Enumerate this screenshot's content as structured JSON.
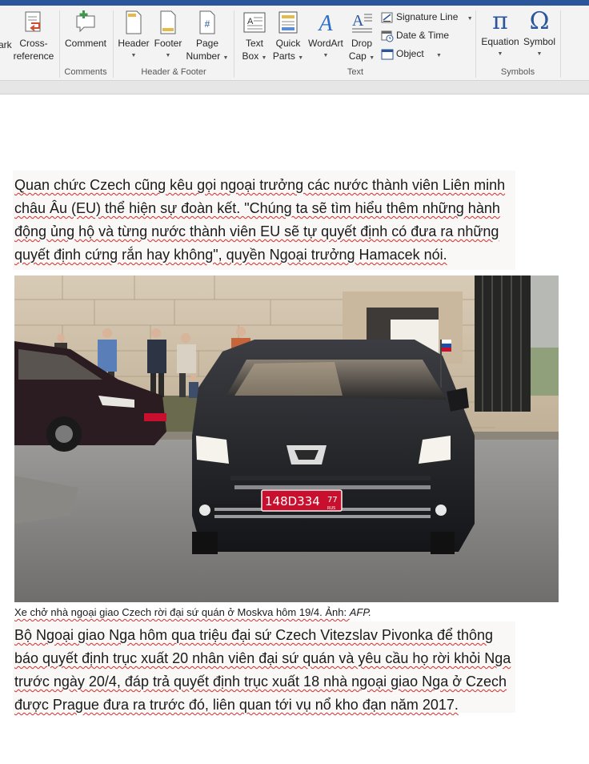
{
  "ribbon": {
    "groups": {
      "comments": "Comments",
      "header_footer": "Header & Footer",
      "text": "Text",
      "symbols": "Symbols"
    },
    "buttons": {
      "bookmark_partial": "ark",
      "cross_reference_1": "Cross-",
      "cross_reference_2": "reference",
      "comment": "Comment",
      "header": "Header",
      "footer": "Footer",
      "page_number_1": "Page",
      "page_number_2": "Number",
      "text_box_1": "Text",
      "text_box_2": "Box",
      "quick_parts_1": "Quick",
      "quick_parts_2": "Parts",
      "wordart": "WordArt",
      "drop_cap_1": "Drop",
      "drop_cap_2": "Cap",
      "signature_line": "Signature Line",
      "date_time": "Date & Time",
      "object": "Object",
      "equation": "Equation",
      "symbol": "Symbol"
    },
    "glyphs": {
      "equation": "π",
      "symbol": "Ω",
      "page_number": "#"
    }
  },
  "document": {
    "para1": {
      "lines": [
        "Quan chức Czech cũng kêu gọi ngoại trưởng các nước thành viên Liên minh",
        "châu Âu (EU) thể hiện sự đoàn kết. \"Chúng ta sẽ tìm hiểu thêm những hành",
        "động ủng hộ và từng nước thành viên EU sẽ tự quyết định có đưa ra những",
        "quyết định cứng rắn hay không\", quyền Ngoại trưởng Hamacek nói."
      ]
    },
    "caption": {
      "text": "Xe chở nhà ngoại giao Czech rời đại sứ quán ở Moskva hôm 19/4. Ảnh: ",
      "credit": "AFP."
    },
    "para2": {
      "lines": [
        "Bộ Ngoại giao Nga hôm qua triệu đại sứ Czech Vitezslav Pivonka để thông",
        "báo quyết định trục xuất 20 nhân viên đại sứ quán và yêu cầu họ rời khỏi Nga",
        "trước ngày 20/4, đáp trả quyết định trục xuất 18 nhà ngoại giao Nga ở Czech",
        "được Prague đưa ra trước đó, liên quan tới vụ nổ kho đạn năm 2017."
      ]
    },
    "photo": {
      "plate_number": "148D334",
      "plate_region": "77",
      "plate_country": "RUS"
    }
  },
  "colors": {
    "accent": "#2b579a",
    "squiggle": "#d52b2b",
    "plate_red": "#c8102e"
  }
}
